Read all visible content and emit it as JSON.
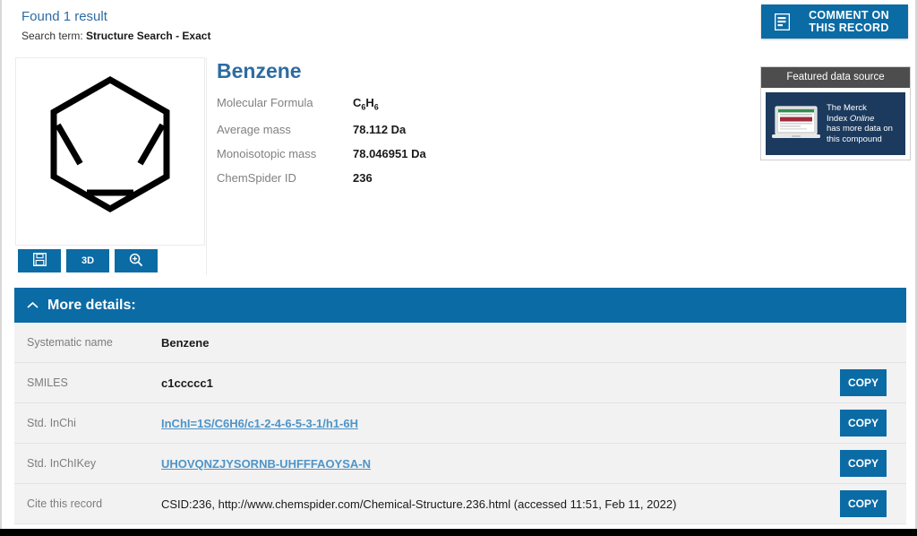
{
  "header": {
    "found_result": "Found 1 result",
    "search_term_label": "Search term:",
    "search_term_value": "Structure Search - Exact",
    "comment_button_line1": "COMMENT ON",
    "comment_button_line2": "THIS RECORD",
    "comment_icon": "document-lines-icon"
  },
  "structure": {
    "alt": "benzene-structure-image",
    "buttons": [
      {
        "name": "save-structure-button",
        "label": "",
        "icon": "floppy-disk-icon"
      },
      {
        "name": "view-3d-button",
        "label": "3D",
        "icon": ""
      },
      {
        "name": "zoom-structure-button",
        "label": "",
        "icon": "magnifier-plus-icon"
      }
    ]
  },
  "compound": {
    "title": "Benzene",
    "properties": [
      {
        "label": "Molecular Formula",
        "value": "C6H6",
        "formula": true
      },
      {
        "label": "Average mass",
        "value": "78.112 Da",
        "formula": false
      },
      {
        "label": "Monoisotopic mass",
        "value": "78.046951 Da",
        "formula": false
      },
      {
        "label": "ChemSpider ID",
        "value": "236",
        "formula": false
      }
    ]
  },
  "featured": {
    "header": "Featured data source",
    "ad_line1": "The Merck",
    "ad_line2_pre": "Index ",
    "ad_line2_em": "Online",
    "ad_line3": "has more data on",
    "ad_line4": "this compound",
    "icon": "laptop-icon"
  },
  "more_details": {
    "bar_label": "More details:",
    "chevron": "chevron-up-icon",
    "copy_label": "COPY",
    "rows": [
      {
        "label": "Systematic name",
        "value": "Benzene",
        "is_link": false,
        "bold": true,
        "copy": false
      },
      {
        "label": "SMILES",
        "value": "c1ccccc1",
        "is_link": false,
        "bold": true,
        "copy": true
      },
      {
        "label": "Std. InChi",
        "value": "InChI=1S/C6H6/c1-2-4-6-5-3-1/h1-6H",
        "is_link": true,
        "bold": true,
        "copy": true
      },
      {
        "label": "Std. InChIKey",
        "value": "UHOVQNZJYSORNB-UHFFFAOYSA-N",
        "is_link": true,
        "bold": true,
        "copy": true
      },
      {
        "label": "Cite this record",
        "value": "CSID:236, http://www.chemspider.com/Chemical-Structure.236.html (accessed 11:51, Feb 11, 2022)",
        "is_link": false,
        "bold": false,
        "copy": true
      }
    ]
  },
  "colors": {
    "brand_blue": "#0b6ba5",
    "link_blue": "#2d6ca2",
    "row_bg": "#f2f2f2",
    "featured_header": "#4d4d4d",
    "merck_navy": "#1b3a5e"
  }
}
